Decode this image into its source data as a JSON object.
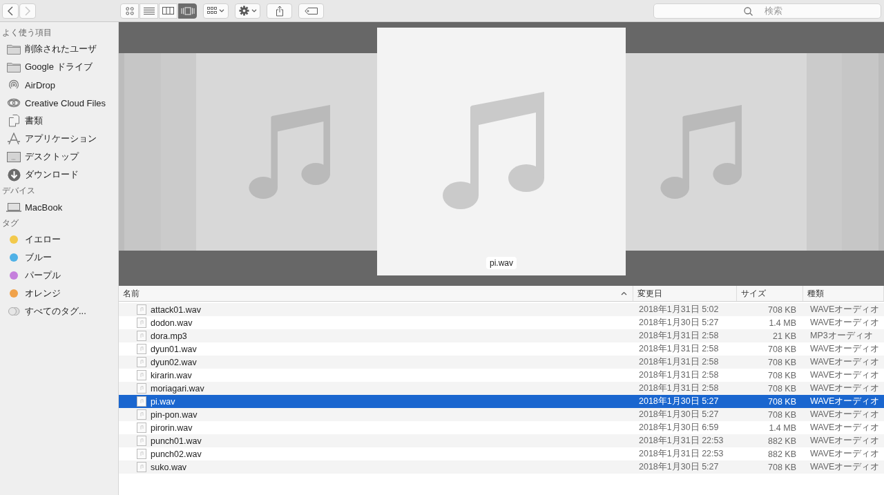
{
  "toolbar": {
    "nav_buttons": [
      {
        "kind": "back",
        "disabled": false
      },
      {
        "kind": "forward",
        "disabled": true
      }
    ],
    "view_buttons": [
      {
        "kind": "icons",
        "selected": false
      },
      {
        "kind": "list",
        "selected": false
      },
      {
        "kind": "columns",
        "selected": false
      },
      {
        "kind": "coverflow",
        "selected": true
      }
    ],
    "action_buttons": [
      {
        "kind": "group"
      },
      {
        "kind": "action"
      },
      {
        "kind": "share"
      },
      {
        "kind": "tag"
      }
    ],
    "search": {
      "placeholder": "検索"
    }
  },
  "sidebar": {
    "sections": [
      {
        "heading": "よく使う項目",
        "items": [
          {
            "label": "削除されたユーザ",
            "kind": "folder"
          },
          {
            "label": "Google ドライブ",
            "kind": "folder"
          },
          {
            "label": "AirDrop",
            "kind": "airdrop"
          },
          {
            "label": "Creative Cloud Files",
            "kind": "cloud"
          },
          {
            "label": "書類",
            "kind": "documents"
          },
          {
            "label": "アプリケーション",
            "kind": "apps"
          },
          {
            "label": "デスクトップ",
            "kind": "desktop"
          },
          {
            "label": "ダウンロード",
            "kind": "downloads"
          }
        ]
      },
      {
        "heading": "デバイス",
        "items": [
          {
            "label": "MacBook",
            "kind": "laptop"
          }
        ]
      },
      {
        "heading": "タグ",
        "items": [
          {
            "label": "イエロー",
            "kind": "tag",
            "color": "#f2c94c"
          },
          {
            "label": "ブルー",
            "kind": "tag",
            "color": "#4fb1e6"
          },
          {
            "label": "パープル",
            "kind": "tag",
            "color": "#c57fdc"
          },
          {
            "label": "オレンジ",
            "kind": "tag",
            "color": "#f0a24a"
          },
          {
            "label": "すべてのタグ...",
            "kind": "all-tags"
          }
        ]
      }
    ]
  },
  "preview": {
    "caption": "pi.wav"
  },
  "table": {
    "columns": [
      {
        "label": "名前",
        "sorted": true
      },
      {
        "label": "変更日",
        "sorted": false
      },
      {
        "label": "サイズ",
        "sorted": false
      },
      {
        "label": "種類",
        "sorted": false
      }
    ],
    "files": [
      {
        "name": "attack01.wav",
        "modified": "2018年1月31日 5:02",
        "size": "708 KB",
        "kind": "WAVEオーディオ",
        "selected": false
      },
      {
        "name": "dodon.wav",
        "modified": "2018年1月30日 5:27",
        "size": "1.4 MB",
        "kind": "WAVEオーディオ",
        "selected": false
      },
      {
        "name": "dora.mp3",
        "modified": "2018年1月31日 2:58",
        "size": "21 KB",
        "kind": "MP3オーディオ",
        "selected": false
      },
      {
        "name": "dyun01.wav",
        "modified": "2018年1月31日 2:58",
        "size": "708 KB",
        "kind": "WAVEオーディオ",
        "selected": false
      },
      {
        "name": "dyun02.wav",
        "modified": "2018年1月31日 2:58",
        "size": "708 KB",
        "kind": "WAVEオーディオ",
        "selected": false
      },
      {
        "name": "kirarin.wav",
        "modified": "2018年1月31日 2:58",
        "size": "708 KB",
        "kind": "WAVEオーディオ",
        "selected": false
      },
      {
        "name": "moriagari.wav",
        "modified": "2018年1月31日 2:58",
        "size": "708 KB",
        "kind": "WAVEオーディオ",
        "selected": false
      },
      {
        "name": "pi.wav",
        "modified": "2018年1月30日 5:27",
        "size": "708 KB",
        "kind": "WAVEオーディオ",
        "selected": true
      },
      {
        "name": "pin-pon.wav",
        "modified": "2018年1月30日 5:27",
        "size": "708 KB",
        "kind": "WAVEオーディオ",
        "selected": false
      },
      {
        "name": "pirorin.wav",
        "modified": "2018年1月30日 6:59",
        "size": "1.4 MB",
        "kind": "WAVEオーディオ",
        "selected": false
      },
      {
        "name": "punch01.wav",
        "modified": "2018年1月31日 22:53",
        "size": "882 KB",
        "kind": "WAVEオーディオ",
        "selected": false
      },
      {
        "name": "punch02.wav",
        "modified": "2018年1月31日 22:53",
        "size": "882 KB",
        "kind": "WAVEオーディオ",
        "selected": false
      },
      {
        "name": "suko.wav",
        "modified": "2018年1月30日 5:27",
        "size": "708 KB",
        "kind": "WAVEオーディオ",
        "selected": false
      }
    ]
  }
}
